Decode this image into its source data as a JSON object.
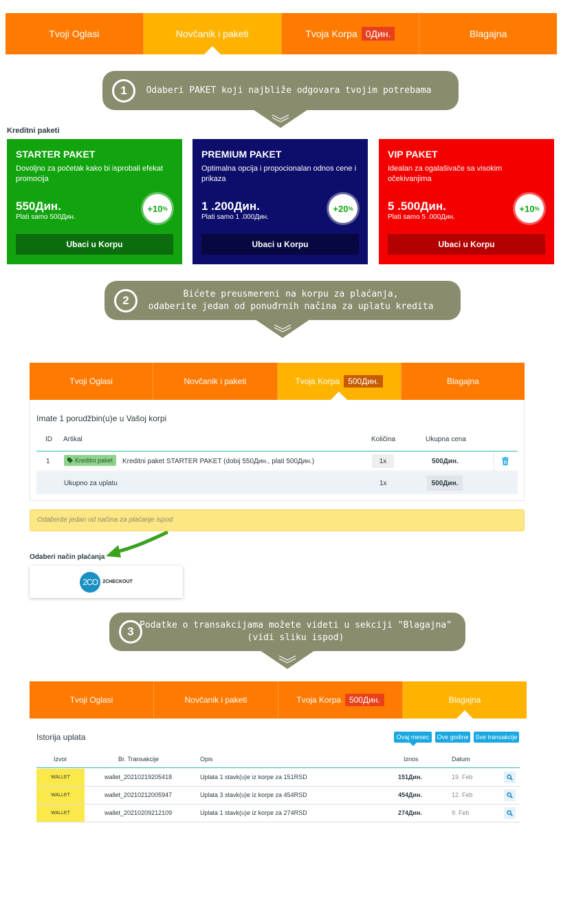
{
  "tabs_top": [
    {
      "label": "Tvoji Oglasi"
    },
    {
      "label": "Novčanik i paketi"
    },
    {
      "label": "Tvoja Korpa",
      "amount": "0Дин."
    },
    {
      "label": "Blagajna"
    }
  ],
  "steps": {
    "step1": {
      "number": "1",
      "text": "Odaberi PAKET koji najbliže odgovara tvojim potrebama"
    },
    "step2": {
      "number": "2",
      "line1": "Bićete preusmereni na korpu za plaćanja,",
      "line2": "odaberite jedan od ponuđrnih načina za uplatu kredita"
    },
    "step3": {
      "number": "3",
      "line1": "Podatke o transakcijama možete videti u sekciji \"Blagajna\"",
      "line2": "(vidi sliku ispod)"
    }
  },
  "packages": {
    "title": "Kreditni paketi",
    "items": [
      {
        "name": "STARTER PAKET",
        "desc": "Dovoljno za početak kako bi isprobali efekat promocija",
        "price": "550Дин.",
        "pay": "Plati samo 500Дин.",
        "bonus": "+10",
        "bonus_unit": "%",
        "button": "Ubaci u Korpu"
      },
      {
        "name": "PREMIUM PAKET",
        "desc": "Optimalna opcija i propocionalan odnos cene i prikaza",
        "price": "1 .200Дин.",
        "pay": "Plati samo 1 .000Дин.",
        "bonus": "+20",
        "bonus_unit": "%",
        "button": "Ubaci u Korpu"
      },
      {
        "name": "VIP PAKET",
        "desc": "Idealan za ogalašivače sa visokim očekivanjima",
        "price": "5 .500Дин.",
        "pay": "Plati samo 5 .000Дин.",
        "bonus": "+10",
        "bonus_unit": "%",
        "button": "Ubaci u Korpu"
      }
    ]
  },
  "tabs_cart": [
    {
      "label": "Tvoji Oglasi"
    },
    {
      "label": "Novčanik i paketi"
    },
    {
      "label": "Tvoja Korpa",
      "amount": "500Дин."
    },
    {
      "label": "Blagajna"
    }
  ],
  "cart": {
    "heading": "Imate 1 porudžbin(u)e u Vašoj korpi",
    "columns": {
      "id": "ID",
      "item": "Artikal",
      "qty": "Količina",
      "total": "Ukupna cena"
    },
    "row": {
      "id": "1",
      "tag": "Kreditni paket",
      "description": "Kreditni paket STARTER PAKET (dobij 550Дин., plati 500Дин.)",
      "qty": "1x",
      "price": "500Дин."
    },
    "total": {
      "label": "Ukupno za uplatu",
      "qty": "1x",
      "price": "500Дин."
    }
  },
  "notice": "Odaberite jedan od načina za plaćanje ispod",
  "payment": {
    "heading": "Odaberi način plaćanja",
    "logo_text": "2CO",
    "name": "2CHECKOUT"
  },
  "tabs_cashier": [
    {
      "label": "Tvoji Oglasi"
    },
    {
      "label": "Novčanik i paketi"
    },
    {
      "label": "Tvoja Korpa",
      "amount": "500Дин."
    },
    {
      "label": "Blagajna"
    }
  ],
  "transactions": {
    "heading": "Istorija uplata",
    "filters": [
      "Ovaj mesec",
      "Ove godine",
      "Sve transakcije"
    ],
    "columns": {
      "source": "Izvor",
      "number": "Br. Transakcije",
      "desc": "Opis",
      "amount": "Iznos",
      "date": "Datum"
    },
    "rows": [
      {
        "source": "WALLET",
        "number": "wallet_20210219205418",
        "desc": "Uplata 1 stavk(u)e iz korpe za 151RSD",
        "amount": "151Дин.",
        "date": "19. Feb"
      },
      {
        "source": "WALLET",
        "number": "wallet_20210212005947",
        "desc": "Uplata 3 stavk(u)e iz korpe za 454RSD",
        "amount": "454Дин.",
        "date": "12. Feb"
      },
      {
        "source": "WALLET",
        "number": "wallet_20210209212109",
        "desc": "Uplata 1 stavk(u)e iz korpe za 274RSD",
        "amount": "274Дин.",
        "date": "9. Feb"
      }
    ]
  },
  "colors": {
    "tab_orange": "#ff7a00",
    "tab_active": "#ffb300",
    "bubble": "#8a8c6e",
    "starter": "#12a40f",
    "premium": "#0d0d6b",
    "vip": "#f50000",
    "accent_blue": "#19a8e0"
  }
}
